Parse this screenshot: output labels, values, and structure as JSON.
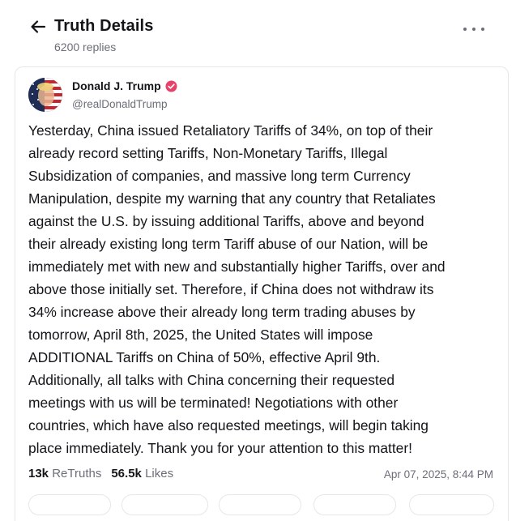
{
  "header": {
    "title": "Truth Details",
    "replies": "6200 replies"
  },
  "post": {
    "author_name": "Donald J. Trump",
    "author_handle": "@realDonaldTrump",
    "text": "Yesterday, China issued Retaliatory Tariffs of 34%, on top of their\nalready record setting Tariffs, Non-Monetary Tariffs, Illegal\nSubsidization of companies, and massive long term Currency\nManipulation, despite my warning that any country that Retaliates\nagainst the U.S. by issuing additional Tariffs, above and beyond\ntheir already existing long term Tariff abuse of our Nation, will be\nimmediately met with new and substantially higher Tariffs, over and\nabove those initially set. Therefore, if China does not withdraw its\n34% increase above their already long term trading abuses by\ntomorrow, April 8th, 2025, the United States will impose\nADDITIONAL Tariffs on China of 50%, effective April 9th.\nAdditionally, all talks with China concerning their requested\nmeetings with us will be terminated! Negotiations with other\ncountries, which have also requested meetings, will begin taking\nplace immediately. Thank you for your attention to this matter!",
    "retruths_count": "13k",
    "retruths_label": "ReTruths",
    "likes_count": "56.5k",
    "likes_label": "Likes",
    "timestamp": "Apr 07, 2025, 8:44 PM"
  },
  "colors": {
    "verified_badge": "#e8426a",
    "muted_text": "#6b6e78"
  }
}
